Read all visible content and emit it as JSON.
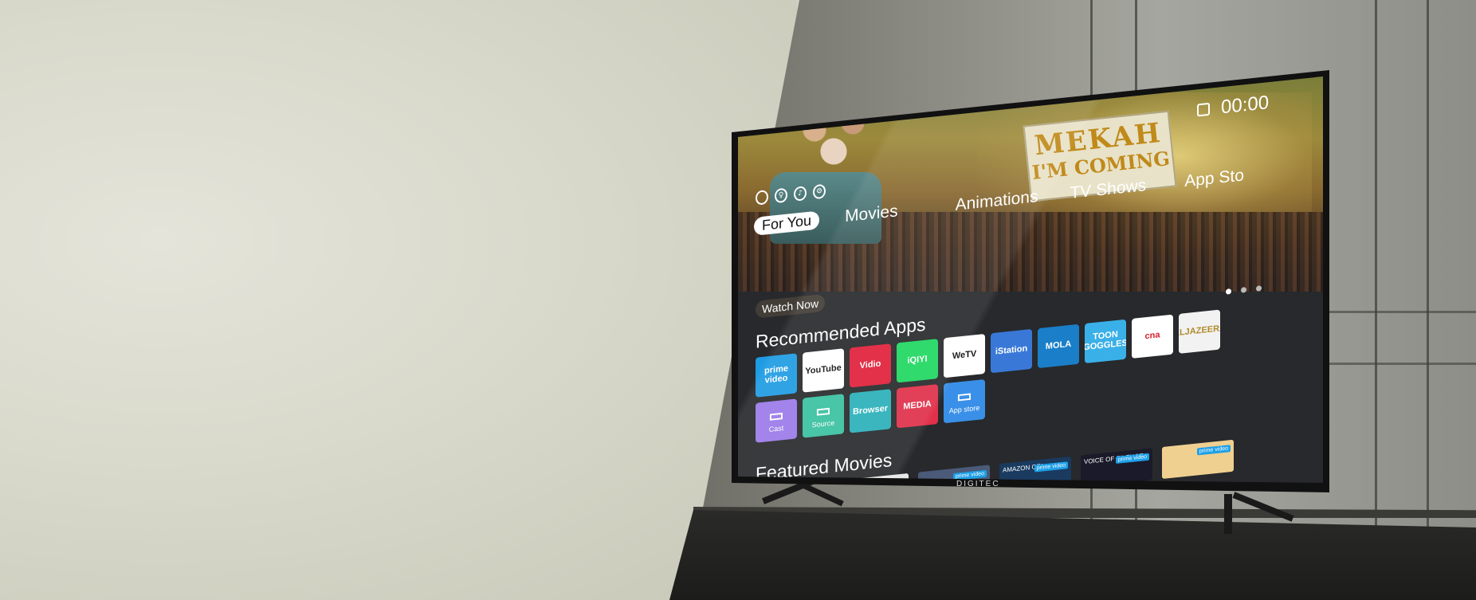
{
  "tv": {
    "brand": "DIGITEC",
    "clock": "00:00",
    "tabs": [
      {
        "label": "For You",
        "active": true
      },
      {
        "label": "Movies",
        "active": false
      },
      {
        "label": "Animations",
        "active": false
      },
      {
        "label": "TV Shows",
        "active": false
      },
      {
        "label": "App Sto",
        "active": false
      }
    ],
    "hero": {
      "banner_line1": "MEKAH",
      "banner_line2": "I'M COMING",
      "watch_now": "Watch Now",
      "carousel_pages": 3,
      "carousel_active": 1
    },
    "recommended_title": "Recommended Apps",
    "apps_row1": [
      {
        "label": "prime video",
        "sub": "",
        "color": "#1e9be3",
        "text_color": "#ffffff"
      },
      {
        "label": "YouTube",
        "sub": "",
        "color": "#ffffff",
        "text_color": "#111111"
      },
      {
        "label": "Vidio",
        "sub": "",
        "color": "#e0203a",
        "text_color": "#ffffff"
      },
      {
        "label": "iQIYI",
        "sub": "",
        "color": "#1ed760",
        "text_color": "#ffffff"
      },
      {
        "label": "WeTV",
        "sub": "",
        "color": "#ffffff",
        "text_color": "#111111"
      },
      {
        "label": "iStation",
        "sub": "",
        "color": "#3a78d8",
        "text_color": "#ffffff"
      },
      {
        "label": "MOLA",
        "sub": "",
        "color": "#1a7fc8",
        "text_color": "#ffffff"
      },
      {
        "label": "TOON GOGGLES",
        "sub": "",
        "color": "#3ab0e8",
        "text_color": "#ffffff"
      },
      {
        "label": "cna",
        "sub": "",
        "color": "#ffffff",
        "text_color": "#d8202a"
      },
      {
        "label": "ALJAZEERA",
        "sub": "",
        "color": "#f2f2f2",
        "text_color": "#b08a2a"
      }
    ],
    "apps_row2": [
      {
        "label": "",
        "sub": "Cast",
        "color": "#9a7ae8",
        "text_color": "#ffffff"
      },
      {
        "label": "",
        "sub": "Source",
        "color": "#3ac0a0",
        "text_color": "#ffffff"
      },
      {
        "label": "Browser",
        "sub": "",
        "color": "#2ab0b8",
        "text_color": "#ffffff"
      },
      {
        "label": "MEDIA",
        "sub": "",
        "color": "#e0304a",
        "text_color": "#ffffff"
      },
      {
        "label": "",
        "sub": "App store",
        "color": "#3a90e8",
        "text_color": "#ffffff"
      }
    ],
    "featured_title": "Featured Movies",
    "movies": [
      {
        "caption": "",
        "color": "#b8902a"
      },
      {
        "caption": "",
        "color": "#e8e8e8"
      },
      {
        "caption": "",
        "color": "#4a5a78"
      },
      {
        "caption": "AMAZON ORI",
        "color": "#1a3a60"
      },
      {
        "caption": "VOICE OF SILENCE",
        "color": "#1a1a2a"
      },
      {
        "caption": "",
        "color": "#f0d090"
      }
    ],
    "movie_badge": "prime video"
  }
}
